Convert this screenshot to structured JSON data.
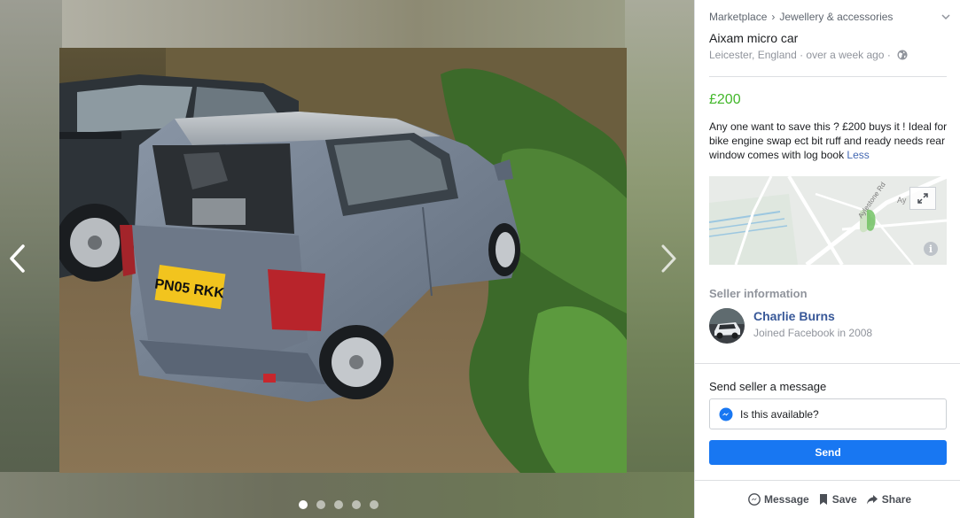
{
  "breadcrumb": {
    "root": "Marketplace",
    "separator": "›",
    "category": "Jewellery & accessories"
  },
  "listing": {
    "title": "Aixam micro car",
    "location": "Leicester, England",
    "posted": "over a week ago",
    "meta_separator": " · ",
    "price": "£200",
    "description": "Any one want to save this ? £200 buys it ! Ideal for bike engine swap ect bit ruff and ready needs rear window comes with log book",
    "less_link": "Less",
    "plate_text": "PN05 RKK"
  },
  "map": {
    "street_label": "Aylestone Rd",
    "place_label": "Ay"
  },
  "seller": {
    "heading": "Seller information",
    "name": "Charlie Burns",
    "joined": "Joined Facebook in 2008"
  },
  "message": {
    "heading": "Send seller a message",
    "value": "Is this available?",
    "send_label": "Send"
  },
  "actions": {
    "message": "Message",
    "save": "Save",
    "share": "Share"
  },
  "gallery": {
    "total_images": 5,
    "current_index": 1
  },
  "colors": {
    "price": "#42b72a",
    "link": "#385898",
    "send_button": "#1877f2"
  },
  "icons": [
    "chevron-left-icon",
    "chevron-right-icon",
    "chevron-down-icon",
    "globe-icon",
    "expand-icon",
    "info-icon",
    "messenger-icon",
    "save-bookmark-icon",
    "share-icon"
  ]
}
